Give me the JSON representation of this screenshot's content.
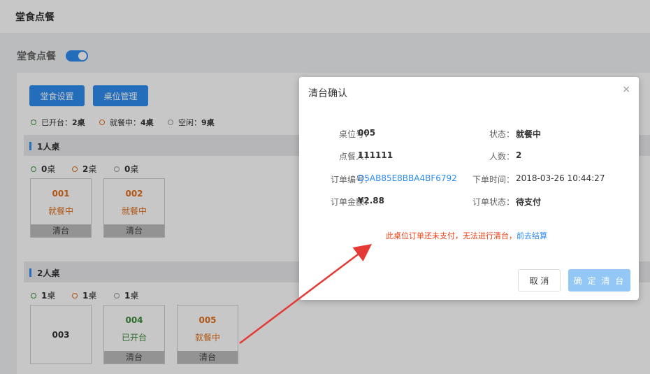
{
  "topbar": {
    "title": "堂食点餐"
  },
  "page": {
    "heading": "堂食点餐",
    "toggle_on": true
  },
  "toolbar": {
    "dine_settings": "堂食设置",
    "table_management": "桌位管理"
  },
  "legend": [
    {
      "color": "green",
      "text": "已开台：",
      "count": "2",
      "unit": "桌"
    },
    {
      "color": "orange",
      "text": "就餐中：",
      "count": "4",
      "unit": "桌"
    },
    {
      "color": "gray",
      "text": "空闲：",
      "count": "9",
      "unit": "桌"
    }
  ],
  "sections": [
    {
      "title": "1人桌",
      "stats": [
        {
          "color": "green",
          "count": "0",
          "unit": "桌"
        },
        {
          "color": "orange",
          "count": "2",
          "unit": "桌"
        },
        {
          "color": "gray",
          "count": "0",
          "unit": "桌"
        }
      ],
      "tables": [
        {
          "number": "001",
          "status": "就餐中",
          "clear": "清台"
        },
        {
          "number": "002",
          "status": "就餐中",
          "clear": "清台"
        }
      ]
    },
    {
      "title": "2人桌",
      "stats": [
        {
          "color": "green",
          "count": "1",
          "unit": "桌"
        },
        {
          "color": "orange",
          "count": "1",
          "unit": "桌"
        },
        {
          "color": "gray",
          "count": "1",
          "unit": "桌"
        }
      ],
      "tables": [
        {
          "number": "003",
          "status": "",
          "clear": ""
        },
        {
          "number": "004",
          "status": "已开台",
          "clear": "清台"
        },
        {
          "number": "005",
          "status": "就餐中",
          "clear": "清台"
        }
      ]
    }
  ],
  "modal": {
    "title": "清台确认",
    "close_icon": "×",
    "fields": {
      "table_no_label": "桌位号：",
      "table_no": "005",
      "status_label": "状态：",
      "status": "就餐中",
      "orderer_label": "点餐人：",
      "orderer": "111111",
      "people_label": "人数：",
      "people": "2",
      "order_no_label": "订单编号：",
      "order_no": "D5AB85E8BBA4BF6792",
      "order_time_label": "下单时间：",
      "order_time": "2018-03-26 10:44:27",
      "amount_label": "订单金额：",
      "amount": "¥2.88",
      "order_status_label": "订单状态：",
      "order_status": "待支付"
    },
    "warning": "此桌位订单还未支付，无法进行清台，",
    "goto_checkout": "前去结算",
    "cancel": "取 消",
    "confirm": "确 定 清 台"
  },
  "colors": {
    "accent": "#2d8cf0",
    "warning": "#ed3f14",
    "in_use": "#e0701e",
    "opened": "#3c8a3c",
    "annotation_arrow": "#e53935"
  }
}
